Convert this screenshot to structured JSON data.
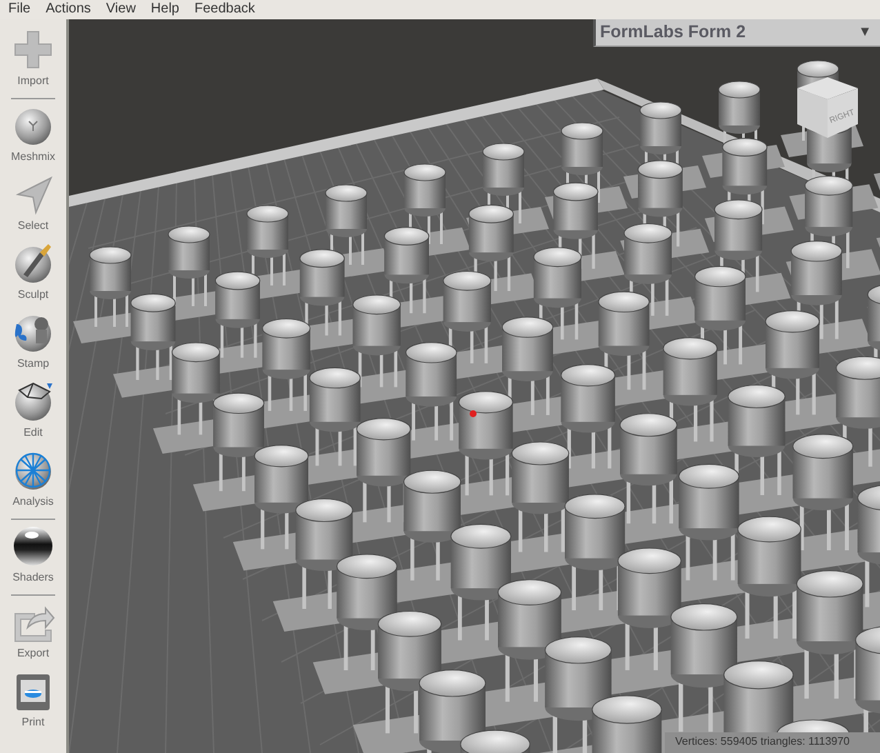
{
  "menu": [
    "File",
    "Actions",
    "View",
    "Help",
    "Feedback"
  ],
  "tools": [
    {
      "label": "Import",
      "kind": "import",
      "divider_after": true
    },
    {
      "label": "Meshmix",
      "kind": "meshmix",
      "divider_after": false
    },
    {
      "label": "Select",
      "kind": "select",
      "divider_after": false
    },
    {
      "label": "Sculpt",
      "kind": "sculpt",
      "divider_after": false
    },
    {
      "label": "Stamp",
      "kind": "stamp",
      "divider_after": false
    },
    {
      "label": "Edit",
      "kind": "edit",
      "divider_after": false
    },
    {
      "label": "Analysis",
      "kind": "analysis",
      "divider_after": true
    },
    {
      "label": "Shaders",
      "kind": "shaders",
      "divider_after": true
    },
    {
      "label": "Export",
      "kind": "export",
      "divider_after": false
    },
    {
      "label": "Print",
      "kind": "print",
      "divider_after": false
    }
  ],
  "printer_panel": {
    "title": "FormLabs Form 2",
    "caret": "▼"
  },
  "view_cube": {
    "face_label": "RIGHT"
  },
  "status_bar": {
    "text": "Vertices: 559405 triangles: 1113970"
  }
}
